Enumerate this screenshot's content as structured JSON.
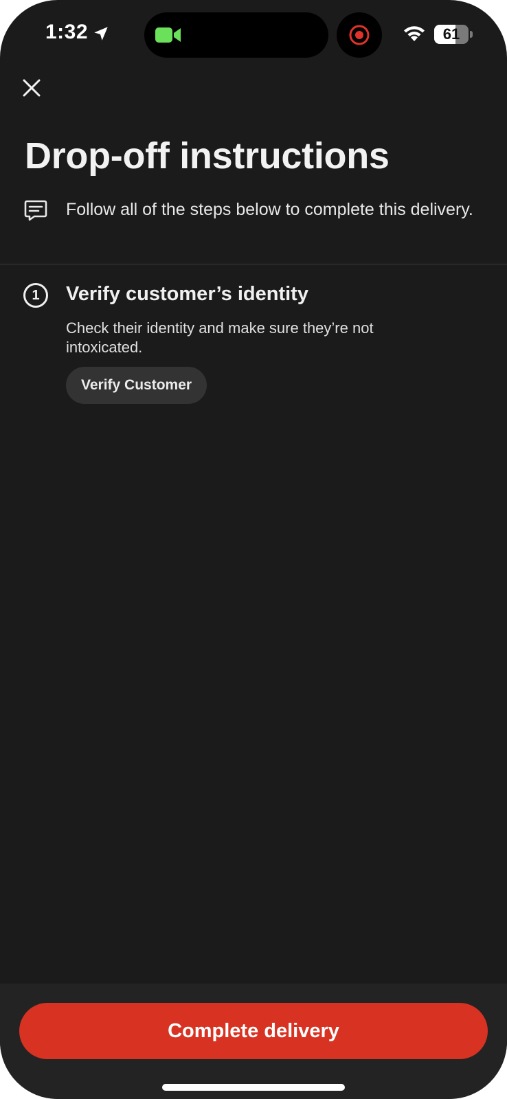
{
  "status_bar": {
    "time": "1:32",
    "battery_text": "61",
    "battery_level": 0.61,
    "icons": [
      "location-arrow-icon",
      "facetime-camera-icon",
      "screen-record-icon",
      "wifi-icon",
      "battery-icon"
    ],
    "facetime_color": "#6be05a",
    "record_color": "#e0332a"
  },
  "header": {
    "close_icon": "close-icon",
    "title": "Drop-off instructions",
    "intro_icon": "chat-message-icon",
    "intro_text": "Follow all of the steps below to complete this delivery."
  },
  "steps": [
    {
      "number": "1",
      "title": "Verify customer’s identity",
      "description": "Check their identity and make sure they’re not intoxicated.",
      "button_label": "Verify Customer"
    }
  ],
  "footer": {
    "primary_button_label": "Complete delivery",
    "primary_color": "#d83222"
  }
}
